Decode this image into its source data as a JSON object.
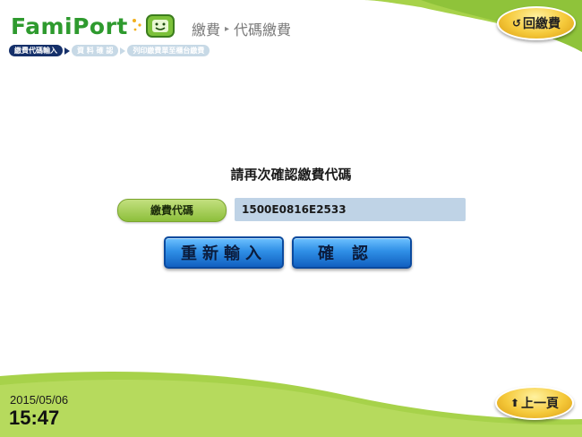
{
  "logo": {
    "text": "FamiPort"
  },
  "breadcrumb": {
    "section": "繳費",
    "separator": "▸",
    "page": "代碼繳費"
  },
  "steps": [
    {
      "label": "繳費代碼輸入",
      "active": true
    },
    {
      "label": "資 料 確 認",
      "active": false
    },
    {
      "label": "列印繳費單至櫃台繳費",
      "active": false
    }
  ],
  "buttons": {
    "back": {
      "icon": "return-icon",
      "label": "回繳費"
    },
    "reenter": {
      "label": "重新輸入"
    },
    "confirm": {
      "label": "確認"
    },
    "prev": {
      "icon": "up-arrow-icon",
      "label": "上一頁"
    }
  },
  "form": {
    "prompt": "請再次確認繳費代碼",
    "code_label": "繳費代碼",
    "code_value": "1500E0816E2533"
  },
  "clock": {
    "date": "2015/05/06",
    "time": "15:47"
  },
  "colors": {
    "green_accent": "#9ccc3c",
    "blue_button": "#2f8fe6",
    "step_active": "#15306a",
    "step_inactive": "#c7d9e6"
  }
}
